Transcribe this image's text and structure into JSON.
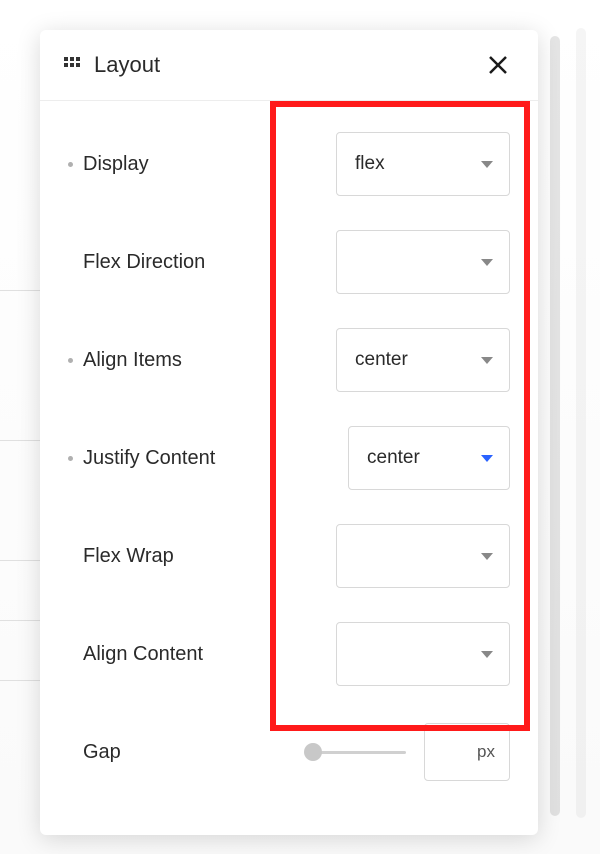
{
  "panel": {
    "title": "Layout"
  },
  "properties": {
    "display": {
      "label": "Display",
      "value": "flex",
      "bullet": true,
      "active": false
    },
    "flexDirection": {
      "label": "Flex Direction",
      "value": "",
      "bullet": false,
      "active": false
    },
    "alignItems": {
      "label": "Align Items",
      "value": "center",
      "bullet": true,
      "active": false
    },
    "justifyContent": {
      "label": "Justify Content",
      "value": "center",
      "bullet": true,
      "active": true
    },
    "flexWrap": {
      "label": "Flex Wrap",
      "value": "",
      "bullet": false,
      "active": false
    },
    "alignContent": {
      "label": "Align Content",
      "value": "",
      "bullet": false,
      "active": false
    },
    "gap": {
      "label": "Gap",
      "unit": "px"
    }
  }
}
